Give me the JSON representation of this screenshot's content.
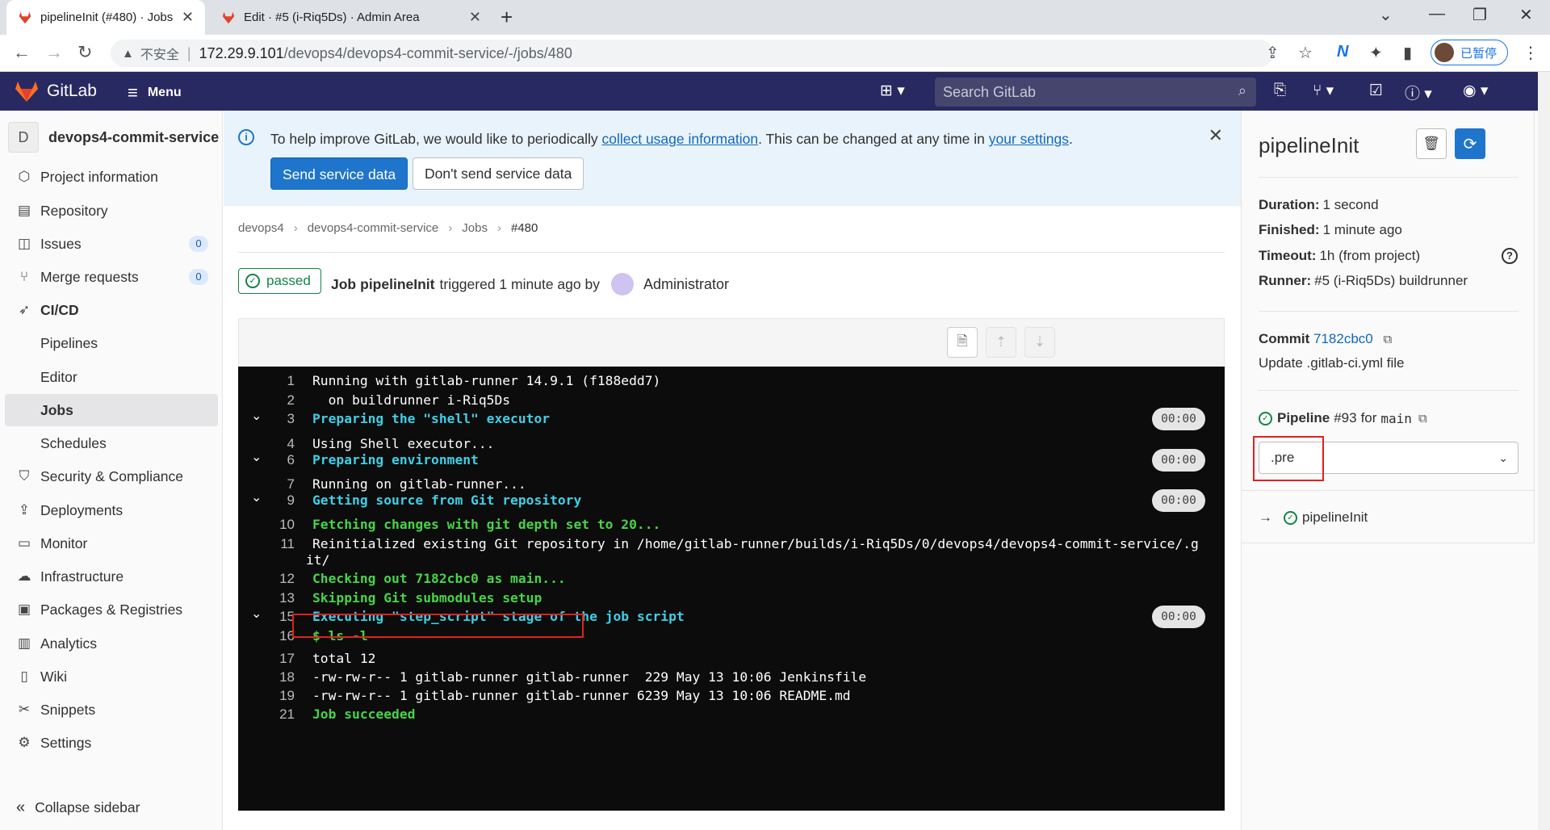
{
  "browser": {
    "tabs": [
      {
        "title": "pipelineInit (#480) · Jobs · devops4",
        "active": true
      },
      {
        "title": "Edit · #5 (i-Riq5Ds) · Admin Area",
        "active": false
      }
    ],
    "address": {
      "insecure_label": "不安全",
      "host": "172.29.9.101",
      "path": "/devops4/devops4-commit-service/-/jobs/480"
    },
    "profile_label": "已暂停"
  },
  "topbar": {
    "brand": "GitLab",
    "menu_label": "Menu",
    "search_placeholder": "Search GitLab"
  },
  "sidebar": {
    "project_initial": "D",
    "project_name": "devops4-commit-service",
    "items": [
      {
        "label": "Project information",
        "icon": "info-icon"
      },
      {
        "label": "Repository",
        "icon": "book-icon"
      },
      {
        "label": "Issues",
        "icon": "issues-icon",
        "count": "0"
      },
      {
        "label": "Merge requests",
        "icon": "merge-request-icon",
        "count": "0"
      },
      {
        "label": "CI/CD",
        "icon": "rocket-icon"
      },
      {
        "label": "Pipelines"
      },
      {
        "label": "Editor"
      },
      {
        "label": "Jobs"
      },
      {
        "label": "Schedules"
      },
      {
        "label": "Security & Compliance",
        "icon": "shield-icon"
      },
      {
        "label": "Deployments",
        "icon": "deployments-icon"
      },
      {
        "label": "Monitor",
        "icon": "monitor-icon"
      },
      {
        "label": "Infrastructure",
        "icon": "cloud-icon"
      },
      {
        "label": "Packages & Registries",
        "icon": "package-icon"
      },
      {
        "label": "Analytics",
        "icon": "chart-icon"
      },
      {
        "label": "Wiki",
        "icon": "wiki-icon"
      },
      {
        "label": "Snippets",
        "icon": "snippet-icon"
      },
      {
        "label": "Settings",
        "icon": "gear-icon"
      }
    ],
    "collapse_label": "Collapse sidebar"
  },
  "banner": {
    "text_1": "To help improve GitLab, we would like to periodically ",
    "link_1": "collect usage information",
    "text_2": ". This can be changed at any time in ",
    "link_2": "your settings",
    "text_3": ".",
    "send_label": "Send service data",
    "dont_send_label": "Don't send service data"
  },
  "breadcrumb": [
    "devops4",
    "devops4-commit-service",
    "Jobs",
    "#480"
  ],
  "job": {
    "status": "passed",
    "job_word": "Job",
    "name": "pipelineInit",
    "triggered_text": "triggered 1 minute ago by",
    "user": "Administrator"
  },
  "log": {
    "lines": [
      {
        "n": "1",
        "text": "Running with gitlab-runner 14.9.1 (f188edd7)",
        "style": "plain"
      },
      {
        "n": "2",
        "text": "  on buildrunner i-Riq5Ds",
        "style": "plain"
      },
      {
        "n": "3",
        "text": "Preparing the \"shell\" executor",
        "style": "cyan",
        "section": true,
        "duration": "00:00"
      },
      {
        "n": "4",
        "text": "Using Shell executor...",
        "style": "plain"
      },
      {
        "n": "6",
        "text": "Preparing environment",
        "style": "cyan",
        "section": true,
        "duration": "00:00"
      },
      {
        "n": "7",
        "text": "Running on gitlab-runner...",
        "style": "plain"
      },
      {
        "n": "9",
        "text": "Getting source from Git repository",
        "style": "cyan",
        "section": true,
        "duration": "00:00"
      },
      {
        "n": "10",
        "text": "Fetching changes with git depth set to 20...",
        "style": "green"
      },
      {
        "n": "11",
        "text": "Reinitialized existing Git repository in /home/gitlab-runner/builds/i-Riq5Ds/0/devops4/devops4-commit-service/.g",
        "style": "plain",
        "wrap": "it/"
      },
      {
        "n": "12",
        "text": "Checking out 7182cbc0 as main...",
        "style": "green"
      },
      {
        "n": "13",
        "text": "Skipping Git submodules setup",
        "style": "green"
      },
      {
        "n": "15",
        "text": "Executing \"step_script\" stage of the job script",
        "style": "cyan",
        "section": true,
        "duration": "00:00"
      },
      {
        "n": "16",
        "text": "$ ls -l",
        "style": "green"
      },
      {
        "n": "17",
        "text": "total 12",
        "style": "plain"
      },
      {
        "n": "18",
        "text": "-rw-rw-r-- 1 gitlab-runner gitlab-runner  229 May 13 10:06 Jenkinsfile",
        "style": "plain"
      },
      {
        "n": "19",
        "text": "-rw-rw-r-- 1 gitlab-runner gitlab-runner 6239 May 13 10:06 README.md",
        "style": "plain"
      },
      {
        "n": "21",
        "text": "Job succeeded",
        "style": "green"
      }
    ]
  },
  "right_sidebar": {
    "title": "pipelineInit",
    "duration_label": "Duration:",
    "duration": "1 second",
    "finished_label": "Finished:",
    "finished": "1 minute ago",
    "timeout_label": "Timeout:",
    "timeout": "1h (from project)",
    "runner_label": "Runner:",
    "runner": "#5 (i-Riq5Ds) buildrunner",
    "commit_label": "Commit",
    "commit_sha": "7182cbc0",
    "commit_message": "Update .gitlab-ci.yml file",
    "pipeline_label": "Pipeline",
    "pipeline_id": "#93",
    "pipeline_for": "for",
    "pipeline_ref": "main",
    "stage_selected": ".pre",
    "job_link": "pipelineInit"
  },
  "colors": {
    "topbar": "#292961",
    "primary": "#1f75cb",
    "success": "#108548",
    "log_cyan": "#3ed0e6",
    "log_green": "#47d447",
    "highlight": "#e02020"
  }
}
